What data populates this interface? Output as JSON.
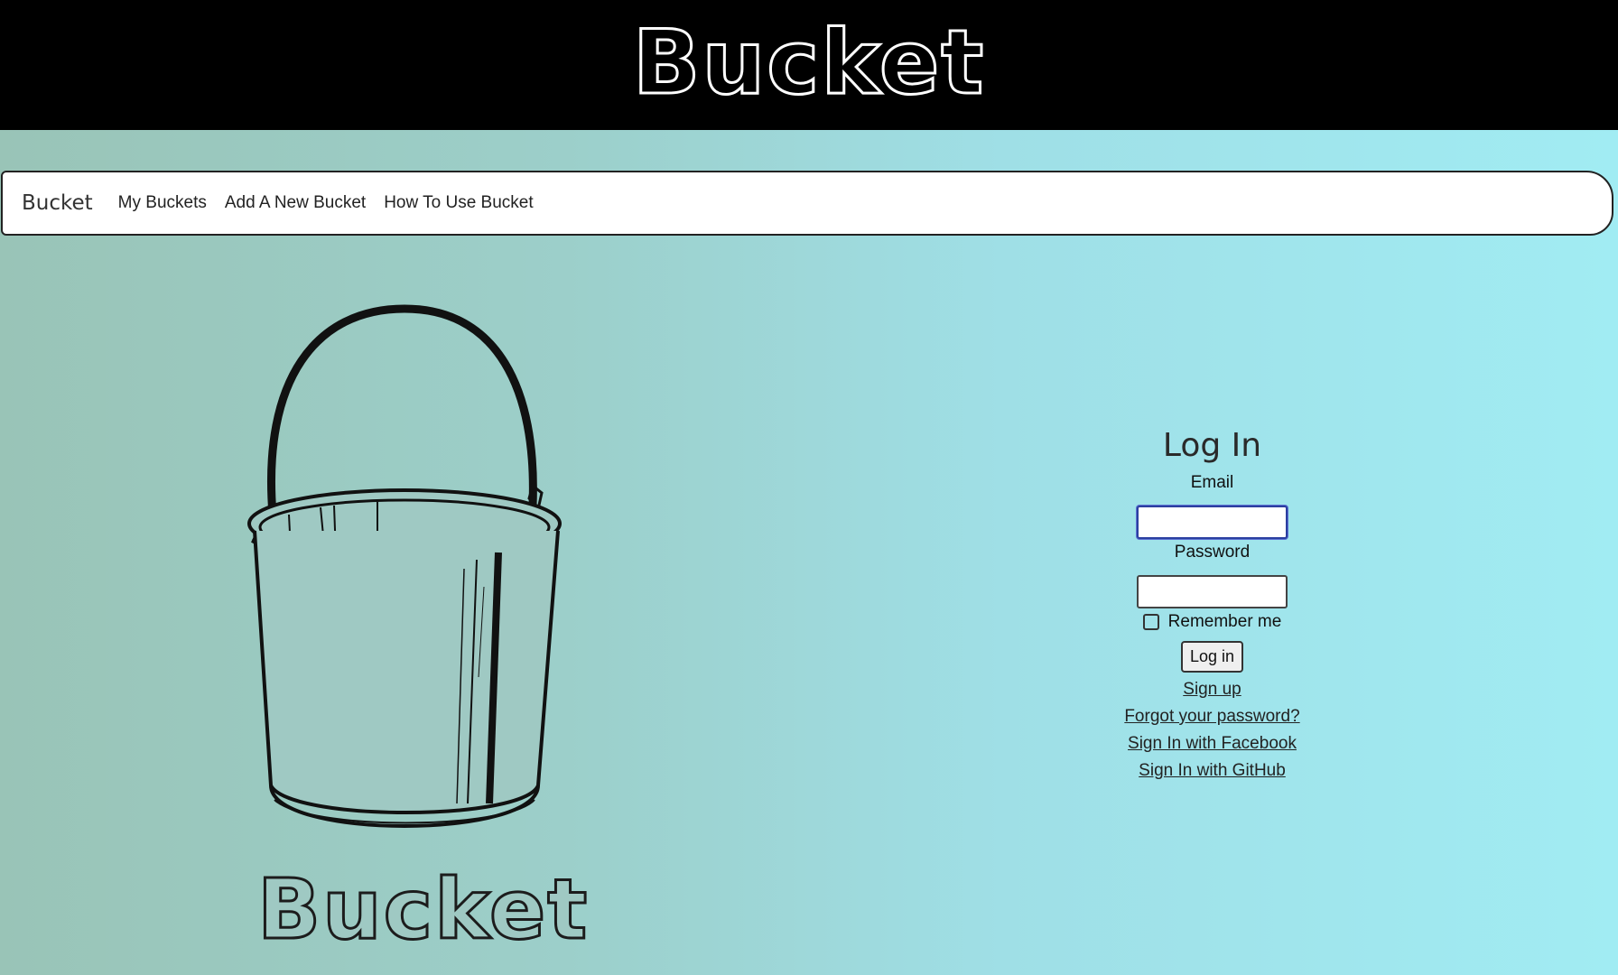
{
  "header": {
    "title": "Bucket"
  },
  "nav": {
    "brand": "Bucket",
    "links": [
      "My Buckets",
      "Add A New Bucket",
      "How To Use Bucket"
    ]
  },
  "hero": {
    "caption": "Bucket"
  },
  "login": {
    "title": "Log In",
    "email_label": "Email",
    "email_value": "",
    "password_label": "Password",
    "password_value": "",
    "remember_label": "Remember me",
    "remember_checked": false,
    "submit_label": "Log in",
    "links": [
      "Sign up",
      "Forgot your password?",
      "Sign In with Facebook",
      "Sign In with GitHub"
    ]
  },
  "colors": {
    "header_bg": "#000000",
    "background_left": "#99c4b7",
    "background_right": "#a1ecf3",
    "input_focus": "#2b3fa0"
  }
}
